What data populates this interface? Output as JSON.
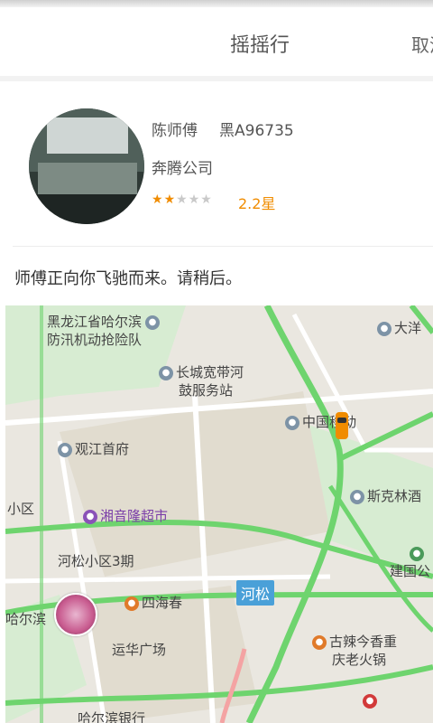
{
  "nav": {
    "title": "摇摇行",
    "cancel_label": "取消"
  },
  "driver": {
    "name": "陈师傅",
    "plate": "黑A96735",
    "company": "奔腾公司",
    "stars_filled": 2,
    "stars_total": 5,
    "rating": "2.2星"
  },
  "status_message": "师傅正向你飞驰而来。请稍后。",
  "map": {
    "pois": [
      {
        "line1": "黑龙江省哈尔滨",
        "line2": "防汛机动抢险队"
      },
      {
        "line1": "长城宽带河",
        "line2": "鼓服务站"
      },
      {
        "label": "观江首府"
      },
      {
        "label": "中国移动"
      },
      {
        "label": "大洋"
      },
      {
        "label": "斯克林酒"
      },
      {
        "label": "小区"
      },
      {
        "label": "湘音隆超市"
      },
      {
        "label": "河松小区3期"
      },
      {
        "label": "四海春"
      },
      {
        "label": "运华广场"
      },
      {
        "label": "建国公"
      },
      {
        "line1": "古辣今香重",
        "line2": "庆老火锅"
      },
      {
        "label": "哈尔滨"
      },
      {
        "label": "哈尔滨银行"
      }
    ],
    "road_tag": "河松"
  },
  "colors": {
    "accent": "#f08c00",
    "road_green": "#6ed46e",
    "road_pink": "#f4a3a3"
  }
}
